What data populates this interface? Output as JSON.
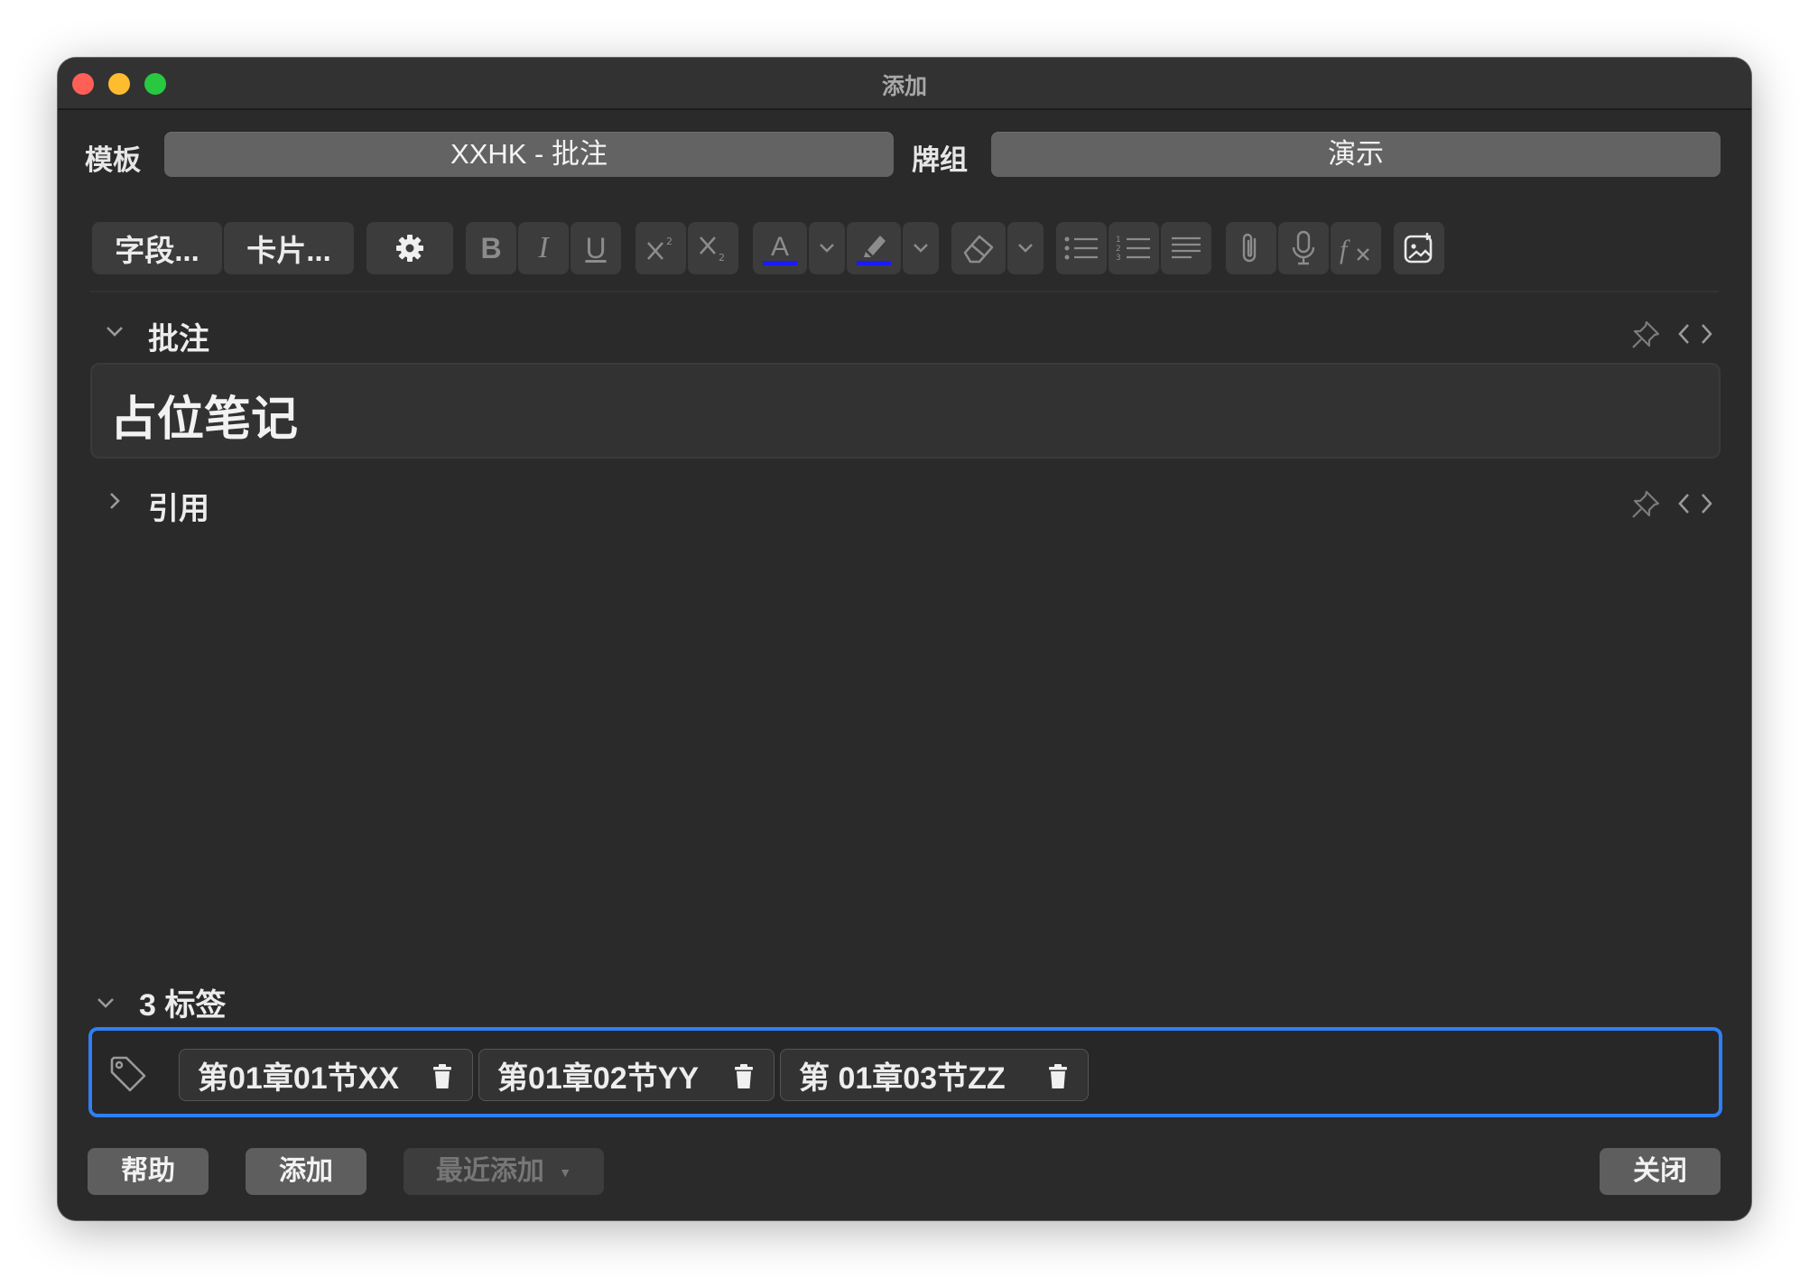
{
  "window": {
    "title": "添加"
  },
  "header": {
    "notetype_label": "模板",
    "notetype_value": "XXHK - 批注",
    "deck_label": "牌组",
    "deck_value": "演示"
  },
  "toolbar": {
    "fields_button": "字段...",
    "cards_button": "卡片...",
    "icons": [
      "gear-icon",
      "bold-icon",
      "italic-icon",
      "underline-icon",
      "superscript-icon",
      "subscript-icon",
      "text-color-icon",
      "highlight-icon",
      "eraser-icon",
      "unordered-list-icon",
      "ordered-list-icon",
      "align-icon",
      "paperclip-icon",
      "microphone-icon",
      "function-icon",
      "image-occlusion-icon"
    ],
    "bold": "B",
    "italic": "I",
    "underline": "U",
    "text_color_letter": "A",
    "color_bar": "#1a1aff"
  },
  "fields": [
    {
      "name": "批注",
      "value": "占位笔记",
      "expanded": true
    },
    {
      "name": "引用",
      "value": "",
      "expanded": false
    }
  ],
  "tags": {
    "header": "3 标签",
    "items": [
      "第01章01节XX",
      "第01章02节YY",
      "第 01章03节ZZ"
    ],
    "focus_color": "#2f7ff6"
  },
  "bottom": {
    "help": "帮助",
    "add": "添加",
    "history": "最近添加",
    "close": "关闭"
  }
}
